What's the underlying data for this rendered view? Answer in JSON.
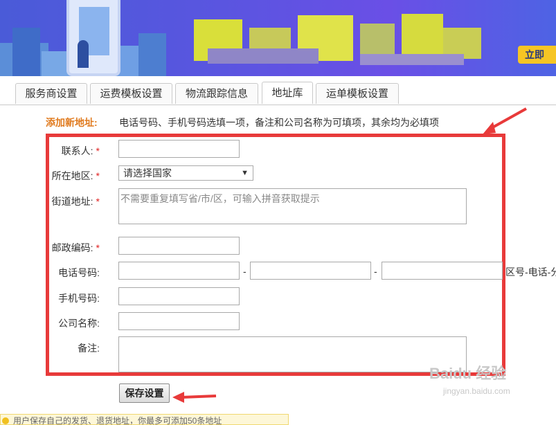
{
  "banner": {
    "button_label": "立即"
  },
  "tabs": [
    {
      "label": "服务商设置"
    },
    {
      "label": "运费模板设置"
    },
    {
      "label": "物流跟踪信息"
    },
    {
      "label": "地址库",
      "active": true
    },
    {
      "label": "运单模板设置"
    }
  ],
  "form": {
    "title": "添加新地址:",
    "hint": "电话号码、手机号码选填一项，备注和公司名称为可填项，其余均为必填项",
    "required_mark": "*",
    "contact_label": "联系人:",
    "region_label": "所在地区:",
    "region_select_value": "请选择国家",
    "street_label": "街道地址:",
    "street_placeholder": "不需要重复填写省/市/区，可输入拼音获取提示",
    "zip_label": "邮政编码:",
    "phone_label": "电话号码:",
    "phone_separator": "-",
    "phone_format_hint": "区号-电话-分机",
    "mobile_label": "手机号码:",
    "company_label": "公司名称:",
    "remark_label": "备注:",
    "save_label": "保存设置"
  },
  "notice": {
    "text": "用户保存自己的发货、退货地址，你最多可添加50条地址"
  },
  "watermark": {
    "text": "Baidu 经验",
    "sub": "jingyan.baidu.com"
  },
  "colors": {
    "highlight": "#e83a3a",
    "title": "#e07a1e",
    "required": "#e02020",
    "banner": "#5a55e0"
  }
}
